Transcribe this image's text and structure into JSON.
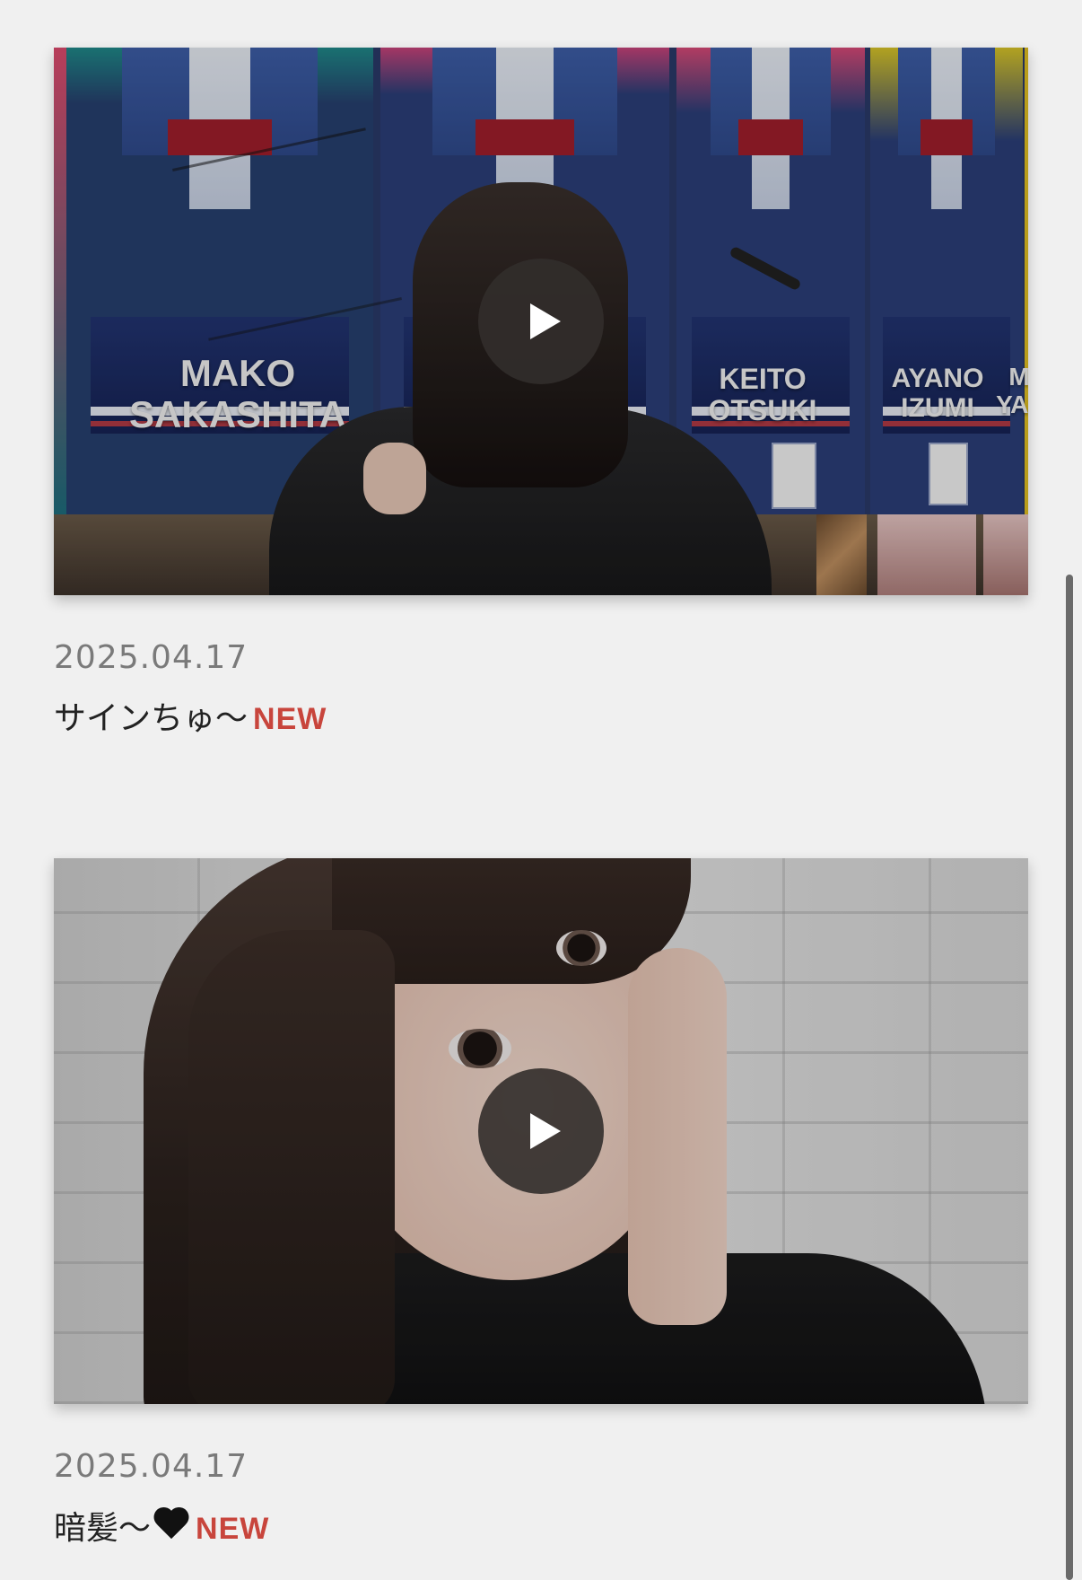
{
  "posts": [
    {
      "date": "2025.04.17",
      "title": "サインちゅ〜",
      "badge": "NEW",
      "poster_names": [
        "MAKO\nSAKASHITA",
        "KEITO\nOTSUKI",
        "AYANO\nIZUMI",
        "MIK\nYAMA"
      ],
      "play_icon": "play-icon"
    },
    {
      "date": "2025.04.17",
      "title": "暗髪〜",
      "title_emoji": "black-heart-icon",
      "badge": "NEW",
      "play_icon": "play-icon"
    }
  ],
  "colors": {
    "background": "#f0f0f0",
    "badge": "#c8453c",
    "date_text": "#7a7a7a",
    "title_text": "#222222",
    "play_button": "#322d2b"
  }
}
